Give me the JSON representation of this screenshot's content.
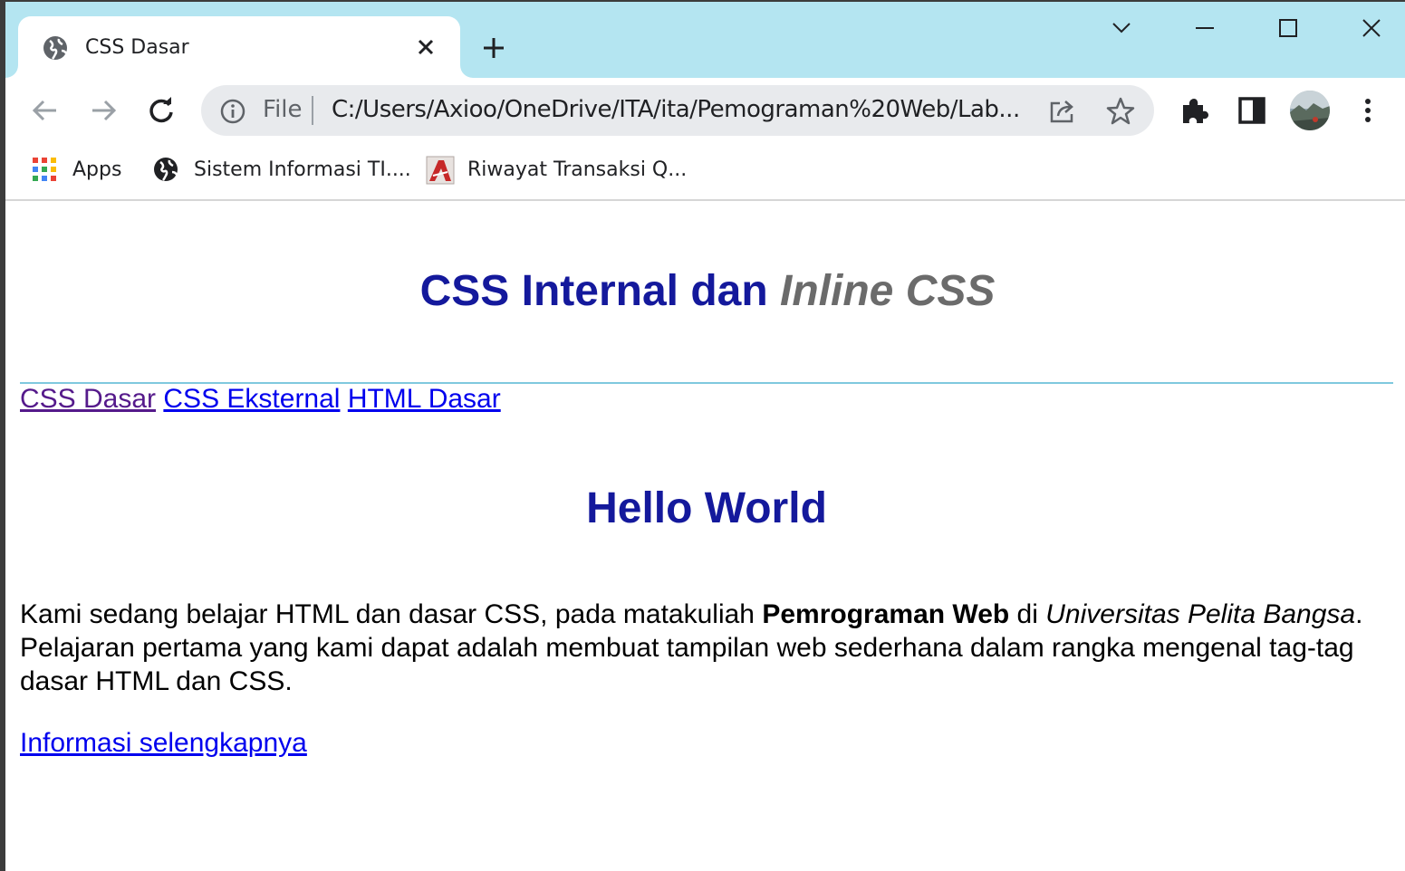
{
  "browser": {
    "tab": {
      "title": "CSS Dasar"
    },
    "address": {
      "scheme": "File",
      "url": "C:/Users/Axioo/OneDrive/ITA/ita/Pemograman%20Web/Lab..."
    },
    "bookmarks": [
      {
        "label": "Apps",
        "icon": "apps-grid-icon"
      },
      {
        "label": "Sistem Informasi TI....",
        "icon": "globe-icon"
      },
      {
        "label": "Riwayat Transaksi Q...",
        "icon": "site-logo-icon"
      }
    ],
    "colors": {
      "tabstrip": "#b4e5f1",
      "omnibox": "#e8eaed"
    }
  },
  "page": {
    "title_regular": "CSS Internal dan",
    "title_italic": "Inline CSS",
    "nav": [
      {
        "label": "CSS Dasar",
        "visited": true
      },
      {
        "label": "CSS Eksternal",
        "visited": false
      },
      {
        "label": "HTML Dasar",
        "visited": false
      }
    ],
    "heading": "Hello World",
    "paragraph": {
      "part1": "Kami sedang belajar HTML dan dasar CSS, pada matakuliah",
      "bold": "Pemrograman Web",
      "part2": "di",
      "italic": "Universitas Pelita Bangsa",
      "part3": ". Pelajaran pertama yang kami dapat adalah membuat tampilan web sederhana dalam rangka mengenal tag-tag dasar HTML dan CSS."
    },
    "more_link": "Informasi selengkapnya",
    "colors": {
      "heading": "#14199c",
      "italic_title": "#6b6b6b",
      "link": "#0000ee",
      "visited": "#551a8b",
      "rule": "#7fc9de"
    }
  }
}
